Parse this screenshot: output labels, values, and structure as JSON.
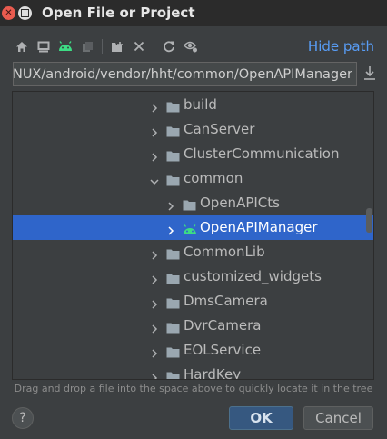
{
  "window": {
    "title": "Open File or Project",
    "close_glyph": "✕"
  },
  "toolbar": {
    "icons": [
      "home-icon",
      "desktop-icon",
      "android-project-icon",
      "module-icon",
      "new-folder-icon",
      "delete-icon",
      "refresh-icon",
      "show-hidden-icon"
    ],
    "hide_path_label": "Hide path"
  },
  "path": {
    "value": "NUX/android/vendor/hht/common/OpenAPIManager"
  },
  "tree": {
    "nodes": [
      {
        "label": "build",
        "depth": 0,
        "expanded": false,
        "icon": "folder-icon",
        "selected": false
      },
      {
        "label": "CanServer",
        "depth": 0,
        "expanded": false,
        "icon": "folder-icon",
        "selected": false
      },
      {
        "label": "ClusterCommunication",
        "depth": 0,
        "expanded": false,
        "icon": "folder-icon",
        "selected": false
      },
      {
        "label": "common",
        "depth": 0,
        "expanded": true,
        "icon": "folder-icon",
        "selected": false
      },
      {
        "label": "OpenAPICts",
        "depth": 1,
        "expanded": false,
        "icon": "folder-icon",
        "selected": false
      },
      {
        "label": "OpenAPIManager",
        "depth": 1,
        "expanded": false,
        "icon": "android-icon",
        "selected": true
      },
      {
        "label": "CommonLib",
        "depth": 0,
        "expanded": false,
        "icon": "folder-icon",
        "selected": false
      },
      {
        "label": "customized_widgets",
        "depth": 0,
        "expanded": false,
        "icon": "folder-icon",
        "selected": false
      },
      {
        "label": "DmsCamera",
        "depth": 0,
        "expanded": false,
        "icon": "folder-icon",
        "selected": false
      },
      {
        "label": "DvrCamera",
        "depth": 0,
        "expanded": false,
        "icon": "folder-icon",
        "selected": false
      },
      {
        "label": "EOLService",
        "depth": 0,
        "expanded": false,
        "icon": "folder-icon",
        "selected": false
      },
      {
        "label": "HardKey",
        "depth": 0,
        "expanded": false,
        "icon": "folder-icon",
        "selected": false
      }
    ]
  },
  "hint": "Drag and drop a file into the space above to quickly locate it in the tree",
  "buttons": {
    "help": "?",
    "ok": "OK",
    "cancel": "Cancel"
  },
  "colors": {
    "selection": "#2f65ca",
    "link": "#589df6",
    "android_green": "#3ddc84",
    "folder": "#9aa7b0"
  }
}
